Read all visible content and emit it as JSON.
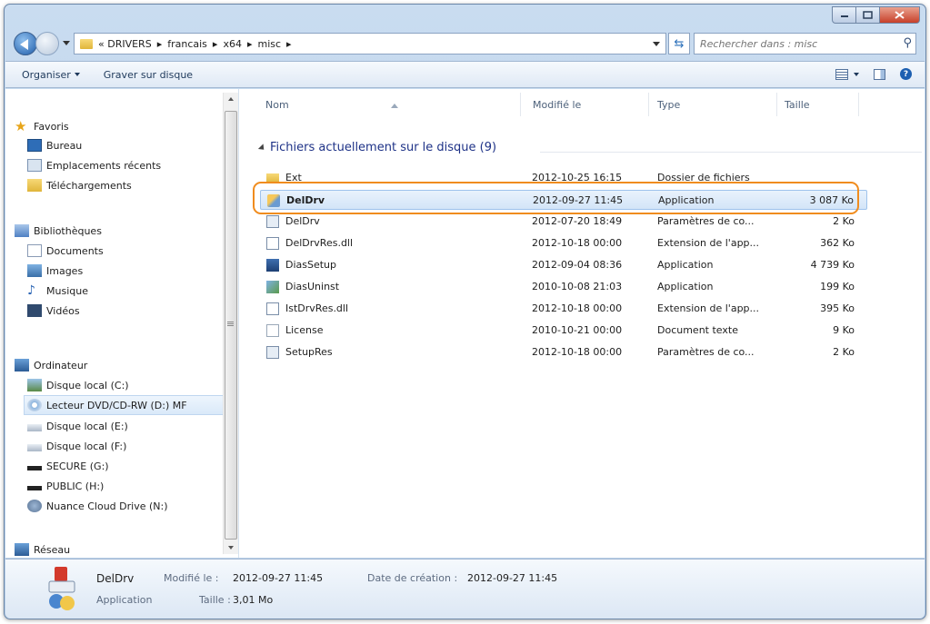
{
  "address": {
    "crumbs": [
      "« DRIVERS",
      "francais",
      "x64",
      "misc"
    ],
    "search_placeholder": "Rechercher dans : misc"
  },
  "toolbar": {
    "organize": "Organiser",
    "burn": "Graver sur disque"
  },
  "nav": {
    "favorites": "Favoris",
    "fav_items": [
      "Bureau",
      "Emplacements récents",
      "Téléchargements"
    ],
    "libraries": "Bibliothèques",
    "lib_items": [
      "Documents",
      "Images",
      "Musique",
      "Vidéos"
    ],
    "computer": "Ordinateur",
    "comp_items": [
      "Disque local (C:)",
      "Lecteur DVD/CD-RW (D:) MF",
      "Disque local (E:)",
      "Disque local (F:)",
      "SECURE (G:)",
      "PUBLIC (H:)",
      "Nuance Cloud Drive (N:)"
    ],
    "network": "Réseau"
  },
  "columns": {
    "name": "Nom",
    "modified": "Modifié le",
    "type": "Type",
    "size": "Taille"
  },
  "group_label": "Fichiers actuellement sur le disque (9)",
  "files": [
    {
      "name": "Ext",
      "modified": "2012-10-25 16:15",
      "type": "Dossier de fichiers",
      "size": ""
    },
    {
      "name": "DelDrv",
      "modified": "2012-09-27 11:45",
      "type": "Application",
      "size": "3 087 Ko"
    },
    {
      "name": "DelDrv",
      "modified": "2012-07-20 18:49",
      "type": "Paramètres de co...",
      "size": "2 Ko"
    },
    {
      "name": "DelDrvRes.dll",
      "modified": "2012-10-18 00:00",
      "type": "Extension de l'app...",
      "size": "362 Ko"
    },
    {
      "name": "DiasSetup",
      "modified": "2012-09-04 08:36",
      "type": "Application",
      "size": "4 739 Ko"
    },
    {
      "name": "DiasUninst",
      "modified": "2010-10-08 21:03",
      "type": "Application",
      "size": "199 Ko"
    },
    {
      "name": "IstDrvRes.dll",
      "modified": "2012-10-18 00:00",
      "type": "Extension de l'app...",
      "size": "395 Ko"
    },
    {
      "name": "License",
      "modified": "2010-10-21 00:00",
      "type": "Document texte",
      "size": "9 Ko"
    },
    {
      "name": "SetupRes",
      "modified": "2012-10-18 00:00",
      "type": "Paramètres de co...",
      "size": "2 Ko"
    }
  ],
  "details": {
    "name": "DelDrv",
    "type": "Application",
    "modified_label": "Modifié le :",
    "modified_value": "2012-09-27 11:45",
    "created_label": "Date de création :",
    "created_value": "2012-09-27 11:45",
    "size_label": "Taille :",
    "size_value": "3,01 Mo"
  },
  "colors": {
    "highlight_ring": "#f08c1e",
    "selection": "#d3e5f8",
    "group_text": "#1e3287"
  }
}
